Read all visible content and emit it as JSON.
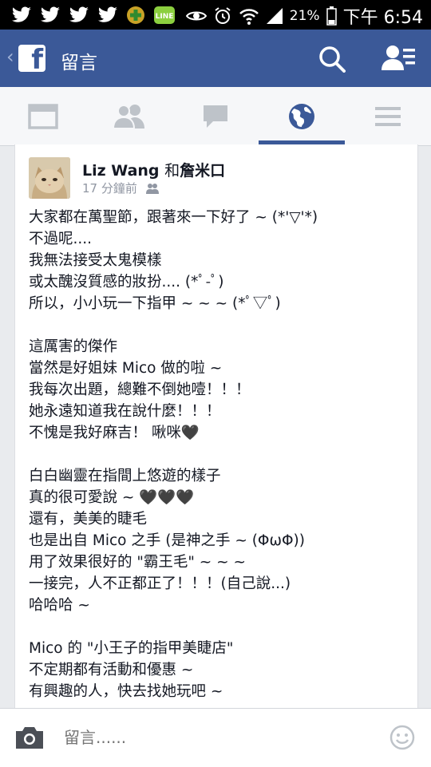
{
  "status_bar": {
    "battery": "21%",
    "time": "下午 6:54",
    "icons": [
      "twitter-icon",
      "twitter-icon",
      "twitter-icon",
      "twitter-icon",
      "plus-app-icon",
      "line-app-icon",
      "eye-icon",
      "alarm-icon",
      "wifi-icon",
      "signal-icon",
      "battery-icon"
    ]
  },
  "nav": {
    "title": "留言",
    "logo_letter": "f",
    "back_glyph": "‹"
  },
  "tabs": [
    {
      "name": "news-feed",
      "icon": "news-feed-icon",
      "active": false
    },
    {
      "name": "friends",
      "icon": "friends-icon",
      "active": false
    },
    {
      "name": "messages",
      "icon": "messages-icon",
      "active": false
    },
    {
      "name": "notifications",
      "icon": "globe-icon",
      "active": true
    },
    {
      "name": "more",
      "icon": "menu-icon",
      "active": false
    }
  ],
  "post": {
    "author": "Liz Wang",
    "connector": "和",
    "tagged": "詹米口",
    "time": "17 分鐘前",
    "lines": [
      "大家都在萬聖節，跟著來一下好了 ~ (*'▽'*)",
      "不過呢....",
      "我無法接受太鬼模樣",
      "或太醜沒質感的妝扮.... (*ﾟ-ﾟ)",
      "所以，小小玩一下指甲 ~ ~ ~ (*ﾟ▽ﾟ)",
      "",
      "這厲害的傑作",
      "當然是好姐妹 Mico 做的啦 ~",
      "我每次出題，總難不倒她噎！！！",
      "她永遠知道我在說什麼！！！",
      "不愧是我好麻吉！ 啾咪🖤",
      "",
      "白白幽靈在指間上悠遊的樣子",
      "真的很可愛說 ~ 🖤🖤🖤",
      "還有，美美的睫毛",
      "也是出自 Mico 之手 (是神之手 ~ (ΦωΦ))",
      "用了效果很好的 \"霸王毛\" ~ ~ ~",
      "一接完，人不正都正了！！！(自己說...)",
      "哈哈哈 ~",
      "",
      "Mico 的 \"小王子的指甲美睫店\"",
      "不定期都有活動和優惠 ~",
      "有興趣的人，快去找她玩吧 ~"
    ]
  },
  "comment_bar": {
    "placeholder": "留言......"
  },
  "colors": {
    "brand": "#3b5998",
    "tab_active": "#3b5998",
    "tab_icon": "#bec3c9"
  }
}
